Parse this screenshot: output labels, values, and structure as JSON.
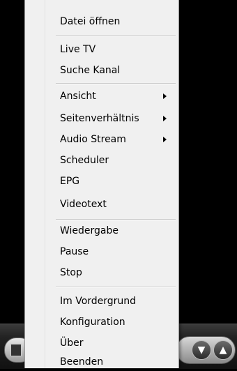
{
  "menu": {
    "items": [
      {
        "label": "Datei öffnen"
      },
      {
        "label": "Live TV"
      },
      {
        "label": "Suche Kanal"
      },
      {
        "label": "Ansicht"
      },
      {
        "label": "Seitenverhältnis"
      },
      {
        "label": "Audio Stream"
      },
      {
        "label": "Scheduler"
      },
      {
        "label": "EPG"
      },
      {
        "label": "Videotext"
      },
      {
        "label": "Wiedergabe"
      },
      {
        "label": "Pause"
      },
      {
        "label": "Stop"
      },
      {
        "label": "Im Vordergrund"
      },
      {
        "label": "Konfiguration"
      },
      {
        "label": "Über"
      },
      {
        "label": "Beenden"
      }
    ]
  },
  "controls": {
    "down_icon": "triangle-down",
    "up_icon": "triangle-up"
  },
  "colors": {
    "menu_bg": "#f0f0f0",
    "separator": "#c8c8c8",
    "background": "#000000"
  }
}
